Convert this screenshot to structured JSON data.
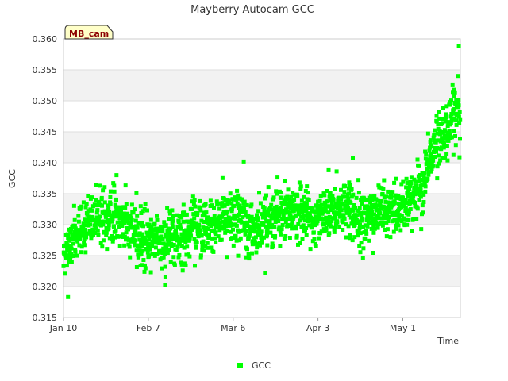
{
  "chart_data": {
    "type": "scatter",
    "title": "Mayberry Autocam GCC",
    "xlabel": "Time",
    "ylabel": "GCC",
    "ylim": [
      0.315,
      0.36
    ],
    "xlim": [
      "2024-01-10",
      "2024-05-20"
    ],
    "yticks": [
      "0.315",
      "0.320",
      "0.325",
      "0.330",
      "0.335",
      "0.340",
      "0.345",
      "0.350",
      "0.355",
      "0.360"
    ],
    "xticks": [
      {
        "date": "2024-01-10",
        "label": "Jan 10"
      },
      {
        "date": "2024-02-07",
        "label": "Feb 7"
      },
      {
        "date": "2024-03-06",
        "label": "Mar 6"
      },
      {
        "date": "2024-04-03",
        "label": "Apr 3"
      },
      {
        "date": "2024-05-01",
        "label": "May 1"
      }
    ],
    "grid": true,
    "banded_background": true,
    "legend_position": "bottom-center",
    "series": [
      {
        "name": "GCC",
        "color": "#00ff00",
        "trend": [
          [
            "2024-01-10",
            0.3255
          ],
          [
            "2024-01-13",
            0.3285
          ],
          [
            "2024-01-18",
            0.3305
          ],
          [
            "2024-01-24",
            0.3315
          ],
          [
            "2024-01-30",
            0.33
          ],
          [
            "2024-02-04",
            0.328
          ],
          [
            "2024-02-09",
            0.327
          ],
          [
            "2024-02-14",
            0.3285
          ],
          [
            "2024-02-20",
            0.3285
          ],
          [
            "2024-02-26",
            0.3295
          ],
          [
            "2024-03-02",
            0.331
          ],
          [
            "2024-03-08",
            0.331
          ],
          [
            "2024-03-13",
            0.3295
          ],
          [
            "2024-03-20",
            0.3315
          ],
          [
            "2024-03-26",
            0.332
          ],
          [
            "2024-04-01",
            0.3305
          ],
          [
            "2024-04-08",
            0.3325
          ],
          [
            "2024-04-15",
            0.332
          ],
          [
            "2024-04-21",
            0.3315
          ],
          [
            "2024-04-26",
            0.332
          ],
          [
            "2024-05-01",
            0.3335
          ],
          [
            "2024-05-06",
            0.336
          ],
          [
            "2024-05-09",
            0.339
          ],
          [
            "2024-05-12",
            0.344
          ],
          [
            "2024-05-16",
            0.3465
          ],
          [
            "2024-05-20",
            0.349
          ]
        ],
        "spread": 0.0022,
        "notable_points": [
          [
            "2024-05-19",
            0.3588
          ],
          [
            "2024-03-09",
            0.3402
          ],
          [
            "2024-04-14",
            0.3408
          ],
          [
            "2024-01-11",
            0.3183
          ],
          [
            "2024-02-12",
            0.3202
          ],
          [
            "2024-03-16",
            0.3222
          ],
          [
            "2024-01-27",
            0.338
          ],
          [
            "2024-04-06",
            0.3388
          ]
        ]
      }
    ],
    "annotation": "MB_cam"
  }
}
